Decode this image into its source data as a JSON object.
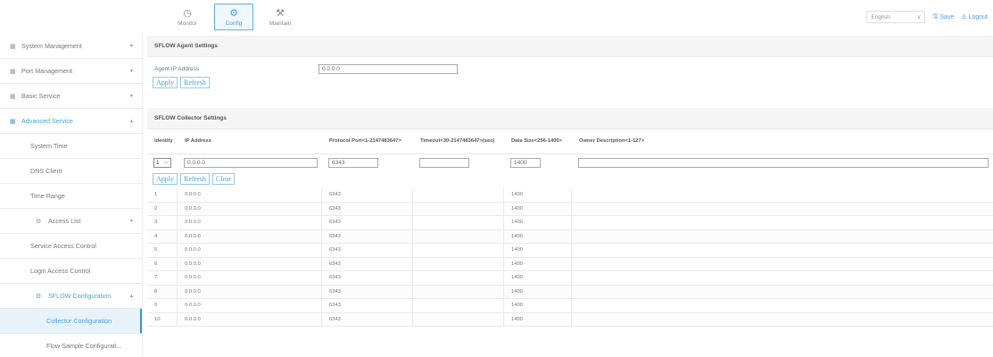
{
  "topnav": [
    {
      "label": "Monitor",
      "icon": "monitor-icon",
      "glyph": "◷"
    },
    {
      "label": "Config",
      "icon": "config-gear-icon",
      "glyph": "⚙"
    },
    {
      "label": "Maintain",
      "icon": "wrench-icon",
      "glyph": "🔧"
    }
  ],
  "header": {
    "language": "English",
    "save_label": "Save",
    "logout_label": "Logout"
  },
  "sidebar": {
    "items": [
      {
        "label": "System Management"
      },
      {
        "label": "Port Management"
      },
      {
        "label": "Basic Service"
      },
      {
        "label": "Advanced Service"
      },
      {
        "label": "System Time"
      },
      {
        "label": "DNS Client"
      },
      {
        "label": "Time Range"
      },
      {
        "label": "Access List"
      },
      {
        "label": "Service Access Control"
      },
      {
        "label": "Login Access Control"
      },
      {
        "label": "SFLOW Configuration"
      },
      {
        "label": "Collector Configuration"
      },
      {
        "label": "Flow Sample Configurati..."
      }
    ]
  },
  "agent": {
    "title": "SFLOW Agent Settings",
    "ip_label": "Agent IP Address",
    "ip_value": "0.0.0.0",
    "apply_label": "Apply",
    "refresh_label": "Refresh"
  },
  "collector": {
    "title": "SFLOW Collector Settings",
    "headers": {
      "identity": "Identity",
      "ip": "IP Address",
      "port": "Protocol Port<1-2147483647>",
      "timeout": "Timeout<30-2147483647>(sec)",
      "datasize": "Data Size<256-1400>",
      "owner": "Owner Description<1-127>"
    },
    "input": {
      "identity": "1",
      "ip": "0.0.0.0",
      "port": "6343",
      "timeout": "",
      "datasize": "1400",
      "owner": ""
    },
    "apply_label": "Apply",
    "refresh_label": "Refresh",
    "clear_label": "Clear",
    "rows": [
      {
        "id": "1",
        "ip": "0.0.0.0",
        "port": "6343",
        "timeout": "",
        "size": "1400"
      },
      {
        "id": "2",
        "ip": "0.0.0.0",
        "port": "6343",
        "timeout": "",
        "size": "1400"
      },
      {
        "id": "3",
        "ip": "0.0.0.0",
        "port": "6343",
        "timeout": "",
        "size": "1400"
      },
      {
        "id": "4",
        "ip": "0.0.0.0",
        "port": "6343",
        "timeout": "",
        "size": "1400"
      },
      {
        "id": "5",
        "ip": "0.0.0.0",
        "port": "6343",
        "timeout": "",
        "size": "1400"
      },
      {
        "id": "6",
        "ip": "0.0.0.0",
        "port": "6343",
        "timeout": "",
        "size": "1400"
      },
      {
        "id": "7",
        "ip": "0.0.0.0",
        "port": "6343",
        "timeout": "",
        "size": "1400"
      },
      {
        "id": "8",
        "ip": "0.0.0.0",
        "port": "6343",
        "timeout": "",
        "size": "1400"
      },
      {
        "id": "9",
        "ip": "0.0.0.0",
        "port": "6343",
        "timeout": "",
        "size": "1400"
      },
      {
        "id": "10",
        "ip": "0.0.0.0",
        "port": "6343",
        "timeout": "",
        "size": "1400"
      }
    ]
  },
  "colors": {
    "accent": "#4a9fd6",
    "selected_bg": "#e6f3fb"
  }
}
